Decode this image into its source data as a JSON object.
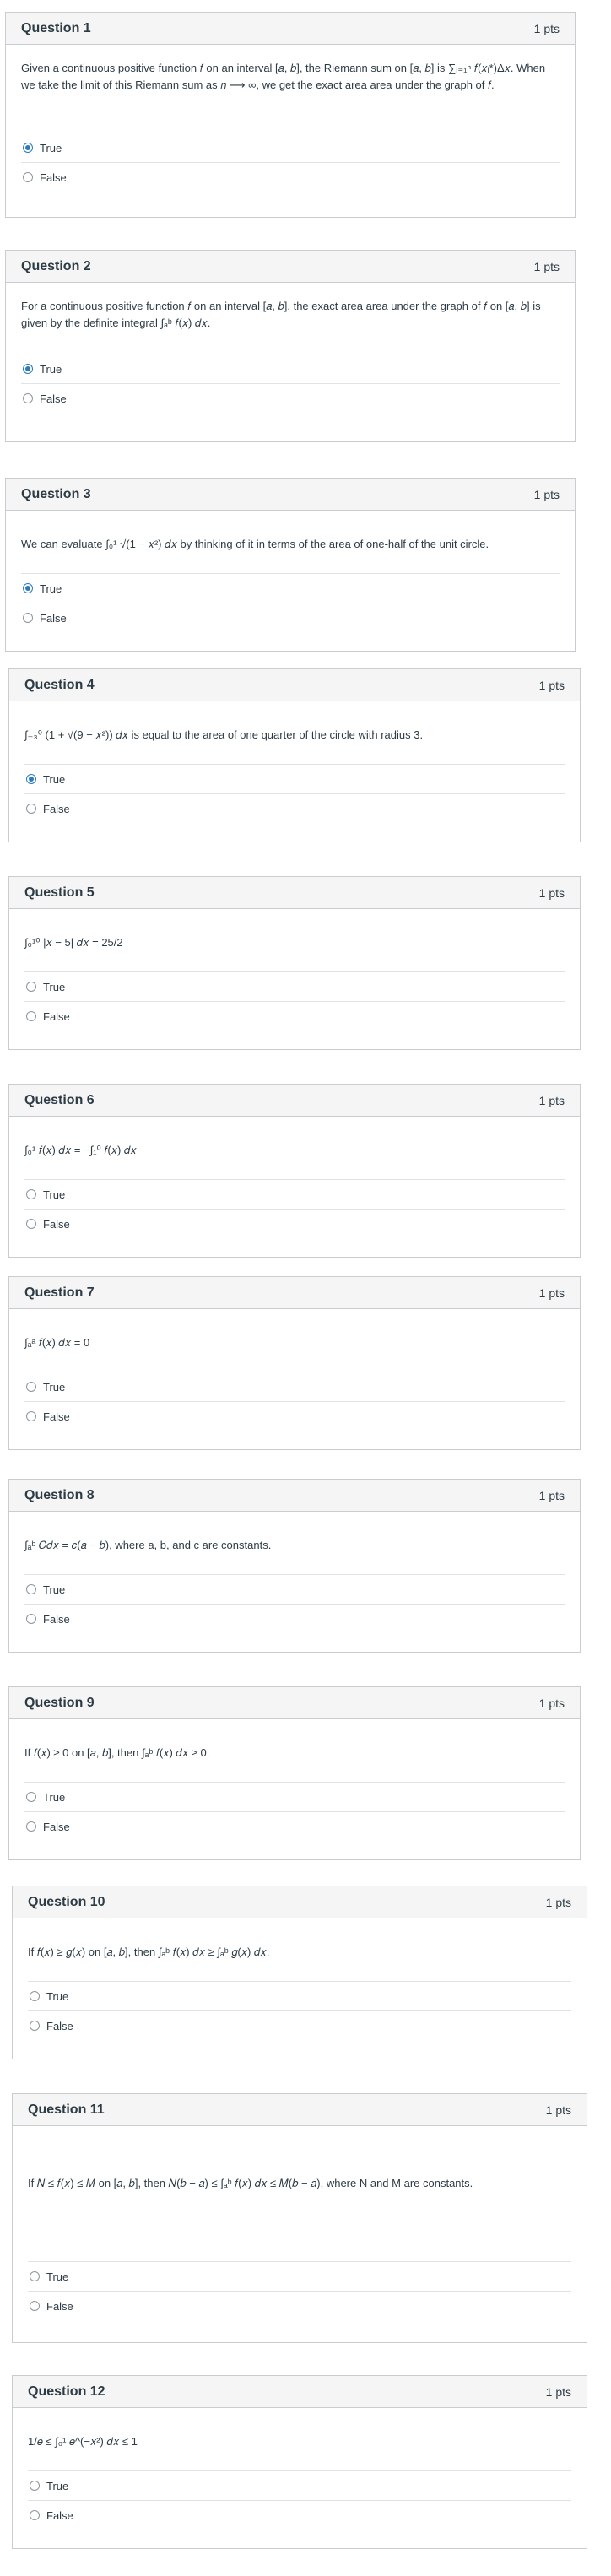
{
  "questions": [
    {
      "title": "Question 1",
      "points": "1 pts",
      "text": "Given a continuous positive function 𝑓 on an interval [𝑎, 𝑏], the Riemann sum on [𝑎, 𝑏] is ∑ᵢ₌₁ⁿ 𝑓(𝑥ᵢ*)Δ𝑥. When we take the limit of this Riemann sum as 𝑛 ⟶ ∞, we get the exact area area under the graph of 𝑓.",
      "answers": [
        {
          "label": "True",
          "selected": true
        },
        {
          "label": "False",
          "selected": false
        }
      ]
    },
    {
      "title": "Question 2",
      "points": "1 pts",
      "text": "For a continuous positive function 𝑓 on an interval [𝑎, 𝑏], the exact area area under the graph of 𝑓 on [𝑎, 𝑏] is given by the definite integral ∫ₐᵇ 𝑓(𝑥) 𝑑𝑥.",
      "answers": [
        {
          "label": "True",
          "selected": true
        },
        {
          "label": "False",
          "selected": false
        }
      ]
    },
    {
      "title": "Question 3",
      "points": "1 pts",
      "text": "We can evaluate ∫₀¹ √(1 − 𝑥²) 𝑑𝑥 by thinking of it in terms of the area of one-half of the unit circle.",
      "answers": [
        {
          "label": "True",
          "selected": true
        },
        {
          "label": "False",
          "selected": false
        }
      ]
    },
    {
      "title": "Question 4",
      "points": "1 pts",
      "text": "∫₋₃⁰ (1 + √(9 − 𝑥²)) 𝑑𝑥 is equal to the area of one quarter of the circle with radius 3.",
      "answers": [
        {
          "label": "True",
          "selected": true
        },
        {
          "label": "False",
          "selected": false
        }
      ]
    },
    {
      "title": "Question 5",
      "points": "1 pts",
      "text": "∫₀¹⁰ |𝑥 − 5| 𝑑𝑥 = 25/2",
      "answers": [
        {
          "label": "True",
          "selected": false
        },
        {
          "label": "False",
          "selected": false
        }
      ]
    },
    {
      "title": "Question 6",
      "points": "1 pts",
      "text": "∫₀¹ 𝑓(𝑥) 𝑑𝑥 = −∫₁⁰ 𝑓(𝑥) 𝑑𝑥",
      "answers": [
        {
          "label": "True",
          "selected": false
        },
        {
          "label": "False",
          "selected": false
        }
      ]
    },
    {
      "title": "Question 7",
      "points": "1 pts",
      "text": "∫ₐᵃ 𝑓(𝑥) 𝑑𝑥 = 0",
      "answers": [
        {
          "label": "True",
          "selected": false
        },
        {
          "label": "False",
          "selected": false
        }
      ]
    },
    {
      "title": "Question 8",
      "points": "1 pts",
      "text": "∫ₐᵇ 𝐶𝑑𝑥 = 𝑐(𝑎 − 𝑏), where a, b, and c are constants.",
      "answers": [
        {
          "label": "True",
          "selected": false
        },
        {
          "label": "False",
          "selected": false
        }
      ]
    },
    {
      "title": "Question 9",
      "points": "1 pts",
      "text": "If 𝑓(𝑥) ≥ 0 on [𝑎, 𝑏], then ∫ₐᵇ 𝑓(𝑥) 𝑑𝑥 ≥ 0.",
      "answers": [
        {
          "label": "True",
          "selected": false
        },
        {
          "label": "False",
          "selected": false
        }
      ]
    },
    {
      "title": "Question 10",
      "points": "1 pts",
      "text": "If 𝑓(𝑥) ≥ 𝑔(𝑥) on [𝑎, 𝑏], then ∫ₐᵇ 𝑓(𝑥) 𝑑𝑥 ≥ ∫ₐᵇ 𝑔(𝑥) 𝑑𝑥.",
      "answers": [
        {
          "label": "True",
          "selected": false
        },
        {
          "label": "False",
          "selected": false
        }
      ]
    },
    {
      "title": "Question 11",
      "points": "1 pts",
      "text": "If 𝑁 ≤ 𝑓(𝑥) ≤ 𝑀 on [𝑎, 𝑏], then 𝑁(𝑏 − 𝑎) ≤ ∫ₐᵇ 𝑓(𝑥) 𝑑𝑥 ≤ 𝑀(𝑏 − 𝑎), where N and M are constants.",
      "answers": [
        {
          "label": "True",
          "selected": false
        },
        {
          "label": "False",
          "selected": false
        }
      ]
    },
    {
      "title": "Question 12",
      "points": "1 pts",
      "text": "1/𝑒 ≤ ∫₀¹ 𝑒^(−𝑥²) 𝑑𝑥 ≤ 1",
      "answers": [
        {
          "label": "True",
          "selected": false
        },
        {
          "label": "False",
          "selected": false
        }
      ]
    }
  ]
}
